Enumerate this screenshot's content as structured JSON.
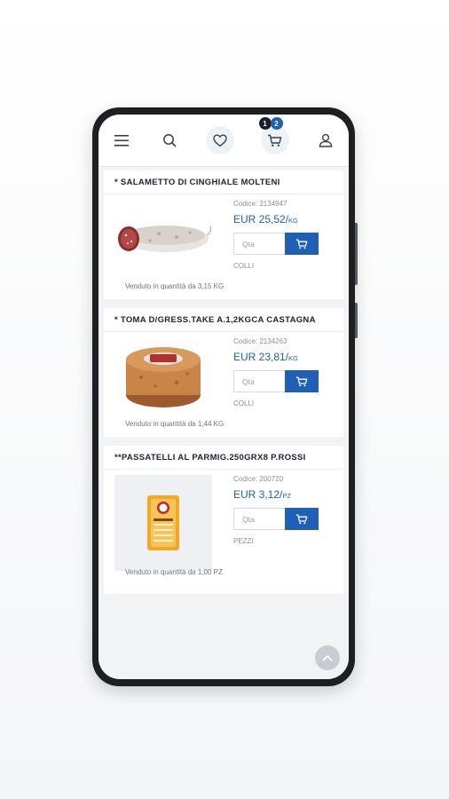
{
  "header": {
    "menu_icon": "hamburger-menu-icon",
    "search_icon": "search-icon",
    "wishlist_icon": "heart-icon",
    "cart_icon": "cart-icon",
    "cart_badge_1": "1",
    "cart_badge_2": "2",
    "account_icon": "user-icon"
  },
  "products": [
    {
      "title": "* SALAMETTO DI CINGHIALE MOLTENI",
      "code": "Codice: 2134947",
      "price": "EUR 25,52/",
      "price_unit": "KG",
      "qty_placeholder": "Qta",
      "unit_label": "COLLI",
      "sold": "Venduto in quantità da 3,15 KG",
      "image": "salami-image"
    },
    {
      "title": "* TOMA D/GRESS.TAKE A.1,2KGCA CASTAGNA",
      "code": "Codice: 2134263",
      "price": "EUR 23,81/",
      "price_unit": "KG",
      "qty_placeholder": "Qta",
      "unit_label": "COLLI",
      "sold": "Venduto in quantità da 1,44 KG",
      "image": "cheese-wheel-image"
    },
    {
      "title": "**PASSATELLI AL PARMIG.250GRX8 P.ROSSI",
      "code": "Codice: 200720",
      "price": "EUR 3,12/",
      "price_unit": "PZ",
      "qty_placeholder": "Qta",
      "unit_label": "PEZZI",
      "sold": "Venduto in quantità da 1,00 PZ",
      "image": "pasta-package-image"
    }
  ],
  "colors": {
    "accent": "#1f5fb6",
    "text": "#1f2330",
    "muted": "#8a8f98"
  }
}
